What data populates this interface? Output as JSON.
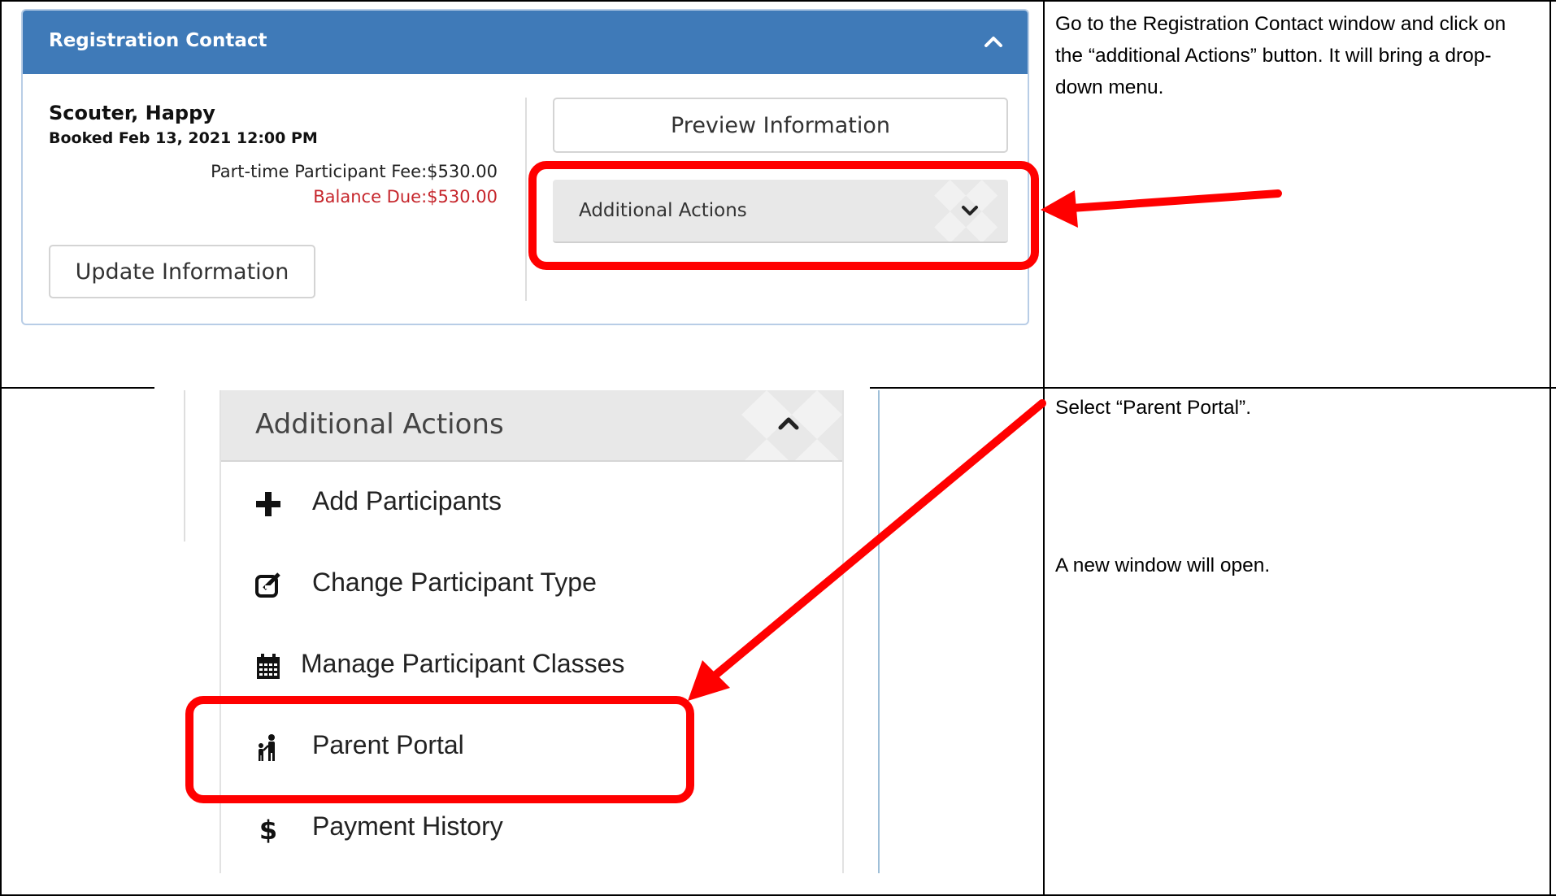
{
  "registration_panel": {
    "title": "Registration Contact",
    "contact_name": "Scouter, Happy",
    "booked": "Booked Feb 13, 2021 12:00 PM",
    "fee": "Part-time Participant Fee:$530.00",
    "balance": "Balance Due:$530.00",
    "update_button": "Update Information",
    "preview_button": "Preview Information",
    "actions_button": "Additional Actions"
  },
  "dropdown_menu": {
    "header": "Additional Actions",
    "items": [
      {
        "label": "Add Participants",
        "icon": "plus-icon"
      },
      {
        "label": "Change Participant Type",
        "icon": "edit-icon"
      },
      {
        "label": "Manage Participant Classes",
        "icon": "calendar-icon"
      },
      {
        "label": "Parent Portal",
        "icon": "parent-child-icon"
      },
      {
        "label": "Payment History",
        "icon": "dollar-icon"
      }
    ]
  },
  "instructions": {
    "step1": "Go to the Registration Contact window and click on the “additional Actions” button.  It will bring a drop-down menu.",
    "step2": "Select “Parent Portal”.",
    "step3": "A new window will open."
  },
  "colors": {
    "panel_header": "#3f7ab8",
    "balance_due": "#c6262c",
    "annotation": "#ff0000"
  }
}
